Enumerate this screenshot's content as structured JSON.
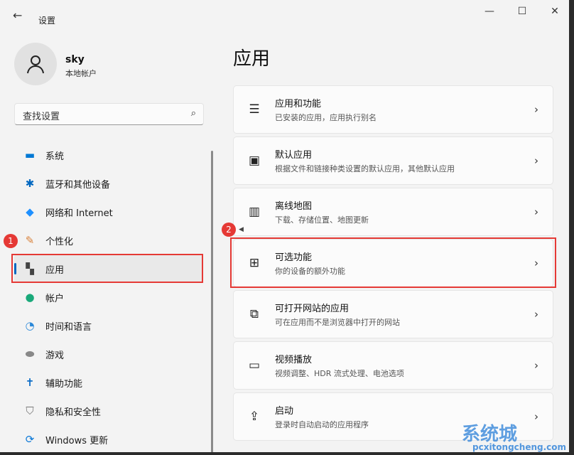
{
  "window": {
    "title": "设置",
    "minimize": "—",
    "maximize": "☐",
    "close": "✕",
    "back": "←"
  },
  "user": {
    "name": "sky",
    "type": "本地帐户"
  },
  "search": {
    "placeholder": "查找设置"
  },
  "nav": [
    {
      "label": "系统",
      "icon": "monitor-icon",
      "glyph": "▬",
      "color": "#0078d4"
    },
    {
      "label": "蓝牙和其他设备",
      "icon": "bluetooth-icon",
      "glyph": "✱",
      "color": "#0067c0"
    },
    {
      "label": "网络和 Internet",
      "icon": "wifi-icon",
      "glyph": "◆",
      "color": "#1e90ff"
    },
    {
      "label": "个性化",
      "icon": "brush-icon",
      "glyph": "✎",
      "color": "#d9823b"
    },
    {
      "label": "应用",
      "icon": "apps-icon",
      "glyph": "▚",
      "color": "#444"
    },
    {
      "label": "帐户",
      "icon": "account-icon",
      "glyph": "●",
      "color": "#1aa97a"
    },
    {
      "label": "时间和语言",
      "icon": "clock-globe-icon",
      "glyph": "◔",
      "color": "#2b88d8"
    },
    {
      "label": "游戏",
      "icon": "gamepad-icon",
      "glyph": "⬬",
      "color": "#888"
    },
    {
      "label": "辅助功能",
      "icon": "accessibility-icon",
      "glyph": "✝",
      "color": "#0a6cc7"
    },
    {
      "label": "隐私和安全性",
      "icon": "shield-icon",
      "glyph": "⛉",
      "color": "#777"
    },
    {
      "label": "Windows 更新",
      "icon": "update-icon",
      "glyph": "⟳",
      "color": "#0a78d7"
    }
  ],
  "page": {
    "title": "应用"
  },
  "cards": [
    {
      "title": "应用和功能",
      "sub": "已安装的应用，应用执行别名",
      "icon": "list-icon",
      "glyph": "☰"
    },
    {
      "title": "默认应用",
      "sub": "根据文件和链接种类设置的默认应用，其他默认应用",
      "icon": "default-app-icon",
      "glyph": "▣"
    },
    {
      "title": "离线地图",
      "sub": "下载、存储位置、地图更新",
      "icon": "map-icon",
      "glyph": "▥"
    },
    {
      "title": "可选功能",
      "sub": "你的设备的额外功能",
      "icon": "optional-features-icon",
      "glyph": "⊞"
    },
    {
      "title": "可打开网站的应用",
      "sub": "可在应用而不是浏览器中打开的网站",
      "icon": "open-link-icon",
      "glyph": "⧉"
    },
    {
      "title": "视频播放",
      "sub": "视频调整、HDR 流式处理、电池选项",
      "icon": "video-icon",
      "glyph": "▭"
    },
    {
      "title": "启动",
      "sub": "登录时自动启动的应用程序",
      "icon": "startup-icon",
      "glyph": "⇪"
    }
  ],
  "annotations": {
    "step1": "1",
    "step2": "2"
  },
  "watermark": {
    "main": "系统城",
    "sub": "pcxitongcheng.com"
  },
  "chevron": "›"
}
